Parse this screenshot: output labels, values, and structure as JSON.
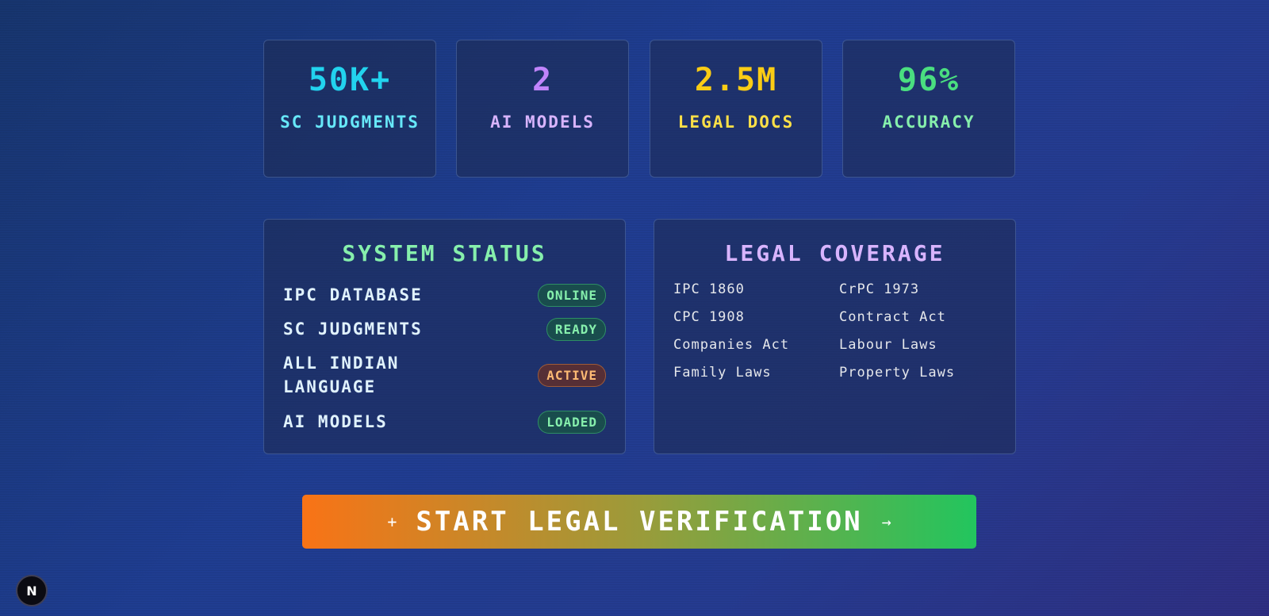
{
  "stats": [
    {
      "value": "50K+",
      "label": "SC JUDGMENTS",
      "color": "#22d3ee"
    },
    {
      "value": "2",
      "label": "AI MODELS",
      "color": "#c084fc"
    },
    {
      "value": "2.5M",
      "label": "LEGAL DOCS",
      "color": "#facc15"
    },
    {
      "value": "96%",
      "label": "ACCURACY",
      "color": "#4ade80"
    }
  ],
  "system_status": {
    "title": "SYSTEM STATUS",
    "items": [
      {
        "label": "IPC DATABASE",
        "status": "ONLINE",
        "status_color": "#86efac"
      },
      {
        "label": "SC JUDGMENTS",
        "status": "READY",
        "status_color": "#86efac"
      },
      {
        "label": "ALL INDIAN LANGUAGE",
        "status": "ACTIVE",
        "status_color": "#fdba74"
      },
      {
        "label": "AI MODELS",
        "status": "LOADED",
        "status_color": "#86efac"
      }
    ]
  },
  "legal_coverage": {
    "title": "LEGAL COVERAGE",
    "items": [
      "IPC 1860",
      "CrPC 1973",
      "CPC 1908",
      "Contract Act",
      "Companies Act",
      "Labour Laws",
      "Family Laws",
      "Property Laws"
    ]
  },
  "cta": {
    "label": "START LEGAL VERIFICATION",
    "left_icon": "plus-icon",
    "right_icon": "arrow-right-icon"
  },
  "n_badge": {
    "label": "N"
  }
}
